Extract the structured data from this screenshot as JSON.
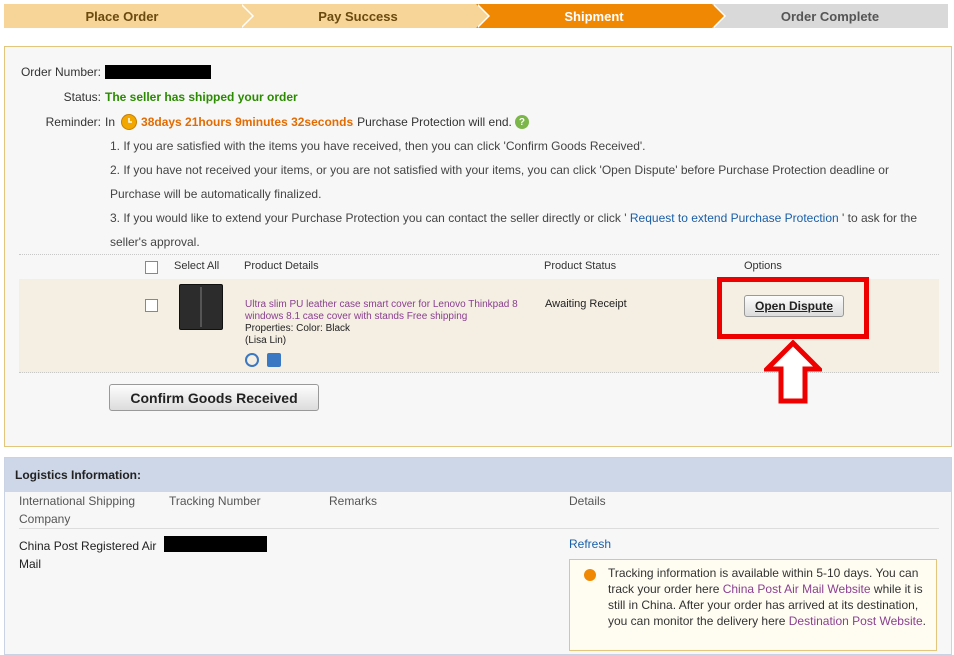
{
  "steps": [
    {
      "label": "Place Order",
      "state": "done"
    },
    {
      "label": "Pay Success",
      "state": "done"
    },
    {
      "label": "Shipment",
      "state": "active"
    },
    {
      "label": "Order Complete",
      "state": "todo"
    }
  ],
  "order": {
    "number_label": "Order Number:",
    "status_label": "Status:",
    "status_value": "The seller has shipped your order",
    "reminder_label": "Reminder:",
    "reminder_in": "In",
    "countdown": "38days 21hours 9minutes 32seconds",
    "reminder_suffix": "Purchase Protection will end.",
    "info1": "1. If you are satisfied with the items you have received, then you can click 'Confirm Goods Received'.",
    "info2a": "2. If you have not received your items, or you are not satisfied with your items, you can click 'Open Dispute' before Purchase Protection deadline or",
    "info2b": "Purchase will be automatically finalized.",
    "info3a_pre": "3. If you would like to extend your Purchase Protection you can contact the seller directly or click '",
    "info3a_link": " Request to extend Purchase Protection ",
    "info3a_post": "' to ask for the",
    "info3b": "seller's approval."
  },
  "table": {
    "select_all": "Select All",
    "col_details": "Product Details",
    "col_status": "Product Status",
    "col_options": "Options"
  },
  "product": {
    "title": "Ultra slim PU leather case smart cover for Lenovo Thinkpad 8 windows 8.1 case cover with stands Free shipping",
    "properties": "Properties: Color: Black",
    "seller": "(Lisa Lin)",
    "status": "Awaiting Receipt",
    "open_dispute": "Open Dispute"
  },
  "confirm_button": "Confirm Goods Received",
  "logistics": {
    "title": "Logistics Information:",
    "col_company": "International Shipping Company",
    "col_tracking": "Tracking Number",
    "col_remarks": "Remarks",
    "col_details": "Details",
    "carrier": "China Post Registered Air Mail",
    "refresh": "Refresh",
    "track_t1": "Tracking information is available within 5-10 days. You can track your order here ",
    "track_link1": "China Post Air Mail Website",
    "track_t2": " while it is still in China. After your order has arrived at its destination, you can monitor the delivery here ",
    "track_link2": "Destination Post Website",
    "track_t3": "."
  },
  "colors": {
    "step_done": "#f7d598",
    "step_active": "#f08804",
    "step_todo": "#d9d9d9",
    "status_green": "#2b8b00",
    "countdown_orange": "#e36b00",
    "link_blue": "#1a5ea8",
    "link_purple": "#8a3f8f",
    "highlight_red": "#ee0000"
  }
}
